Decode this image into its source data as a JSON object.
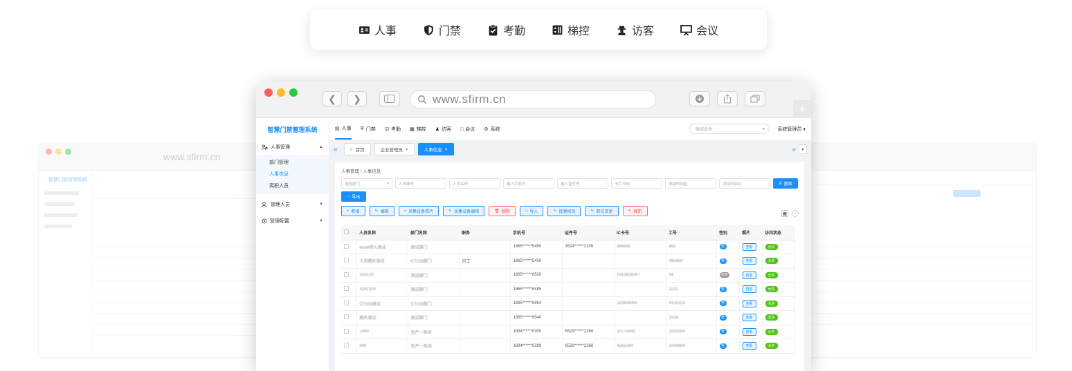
{
  "module_tabs": [
    {
      "label": "人事",
      "icon": "id-card-icon"
    },
    {
      "label": "门禁",
      "icon": "shield-icon"
    },
    {
      "label": "考勤",
      "icon": "clipboard-check-icon"
    },
    {
      "label": "梯控",
      "icon": "elevator-icon"
    },
    {
      "label": "访客",
      "icon": "visitor-icon"
    },
    {
      "label": "会议",
      "icon": "presentation-icon"
    }
  ],
  "browser": {
    "url": "www.sfirm.cn",
    "plus": "+"
  },
  "app": {
    "title": "智慧门禁管理系统",
    "topnav": [
      {
        "label": "人事",
        "icon": "id-card-icon"
      },
      {
        "label": "门禁",
        "icon": "shield-icon"
      },
      {
        "label": "考勤",
        "icon": "clipboard-check-icon"
      },
      {
        "label": "梯控",
        "icon": "elevator-icon"
      },
      {
        "label": "访客",
        "icon": "visitor-icon"
      },
      {
        "label": "会议",
        "icon": "presentation-icon"
      },
      {
        "label": "系统",
        "icon": "gear-icon"
      }
    ],
    "company_select": "测试企业",
    "admin_menu": "系统管理员",
    "sidebar": {
      "groups": [
        {
          "label": "人事管理",
          "items": [
            "部门管理",
            "人事信息",
            "离职人员"
          ],
          "active_item": "人事信息"
        },
        {
          "label": "管理人员"
        },
        {
          "label": "管理配置"
        }
      ]
    },
    "page_tabs": [
      {
        "label": "首页"
      },
      {
        "label": "企业管理员",
        "close": "×"
      },
      {
        "label": "人事信息",
        "close": "×"
      }
    ],
    "breadcrumb": "人事管理 / 人事信息",
    "filters": {
      "dept": "选择部门",
      "placeholders": [
        "人员编号",
        "人员名称",
        "输入手机号",
        "输入证件号",
        "卡片号码",
        "添加时间起",
        "添加时间止"
      ],
      "search": "搜索",
      "export": "导出"
    },
    "actions": [
      "新增",
      "编辑",
      "采集设备照片",
      "采集设备编辑",
      "删除",
      "导入",
      "批量修改",
      "职位变更",
      "离职"
    ],
    "table": {
      "columns": [
        "人员名称",
        "部门名称",
        "职务",
        "手机号",
        "证件号",
        "IC卡号",
        "工号",
        "性别",
        "照片",
        "访问状态"
      ],
      "rows": [
        {
          "name": "excel导入测试",
          "dept": "测试部门",
          "job": "",
          "phone": "1865******5450",
          "cert": "3624******2105",
          "ic": "984582",
          "no": "862",
          "sex": "男",
          "photo": "查看",
          "status": "允许"
        },
        {
          "name": "人员照片测试",
          "dept": "CT103部门",
          "job": "员工",
          "phone": "1865******5450",
          "cert": "",
          "ic": "",
          "no": "365450",
          "sex": "男",
          "photo": "查看",
          "status": "允许"
        },
        {
          "name": "324123",
          "dept": "测试部门",
          "job": "",
          "phone": "1865******8520",
          "cert": "",
          "ic": "0113626067",
          "no": "54",
          "sex": "未知",
          "photo": "查看",
          "status": "允许"
        },
        {
          "name": "3141324",
          "dept": "测试部门",
          "job": "",
          "phone": "1865******8485",
          "cert": "",
          "ic": "",
          "no": "3211",
          "sex": "男",
          "photo": "查看",
          "status": "允许"
        },
        {
          "name": "CT103测试",
          "dept": "CT103部门",
          "job": "",
          "phone": "1865******5954",
          "cert": "",
          "ic": "113626055",
          "no": "4124123",
          "sex": "男",
          "photo": "查看",
          "status": "允许"
        },
        {
          "name": "图片测试",
          "dept": "测试部门",
          "job": "",
          "phone": "1865******9540",
          "cert": "",
          "ic": "",
          "no": "3134",
          "sex": "男",
          "photo": "查看",
          "status": "允许"
        },
        {
          "name": "1000",
          "dept": "生产一车间",
          "job": "",
          "phone": "1894******0300",
          "cert": "6529******2268",
          "ic": "10775442",
          "no": "1001000",
          "sex": "男",
          "photo": "查看",
          "status": "允许"
        },
        {
          "name": "999",
          "dept": "生产一车间",
          "job": "",
          "phone": "1894******0299",
          "cert": "6529******2268",
          "ic": "4261344",
          "no": "1000999",
          "sex": "男",
          "photo": "查看",
          "status": "允许"
        }
      ]
    }
  },
  "ghost_left": {
    "url": "www.sfirm.cn",
    "title": "智慧门禁管理系统"
  }
}
